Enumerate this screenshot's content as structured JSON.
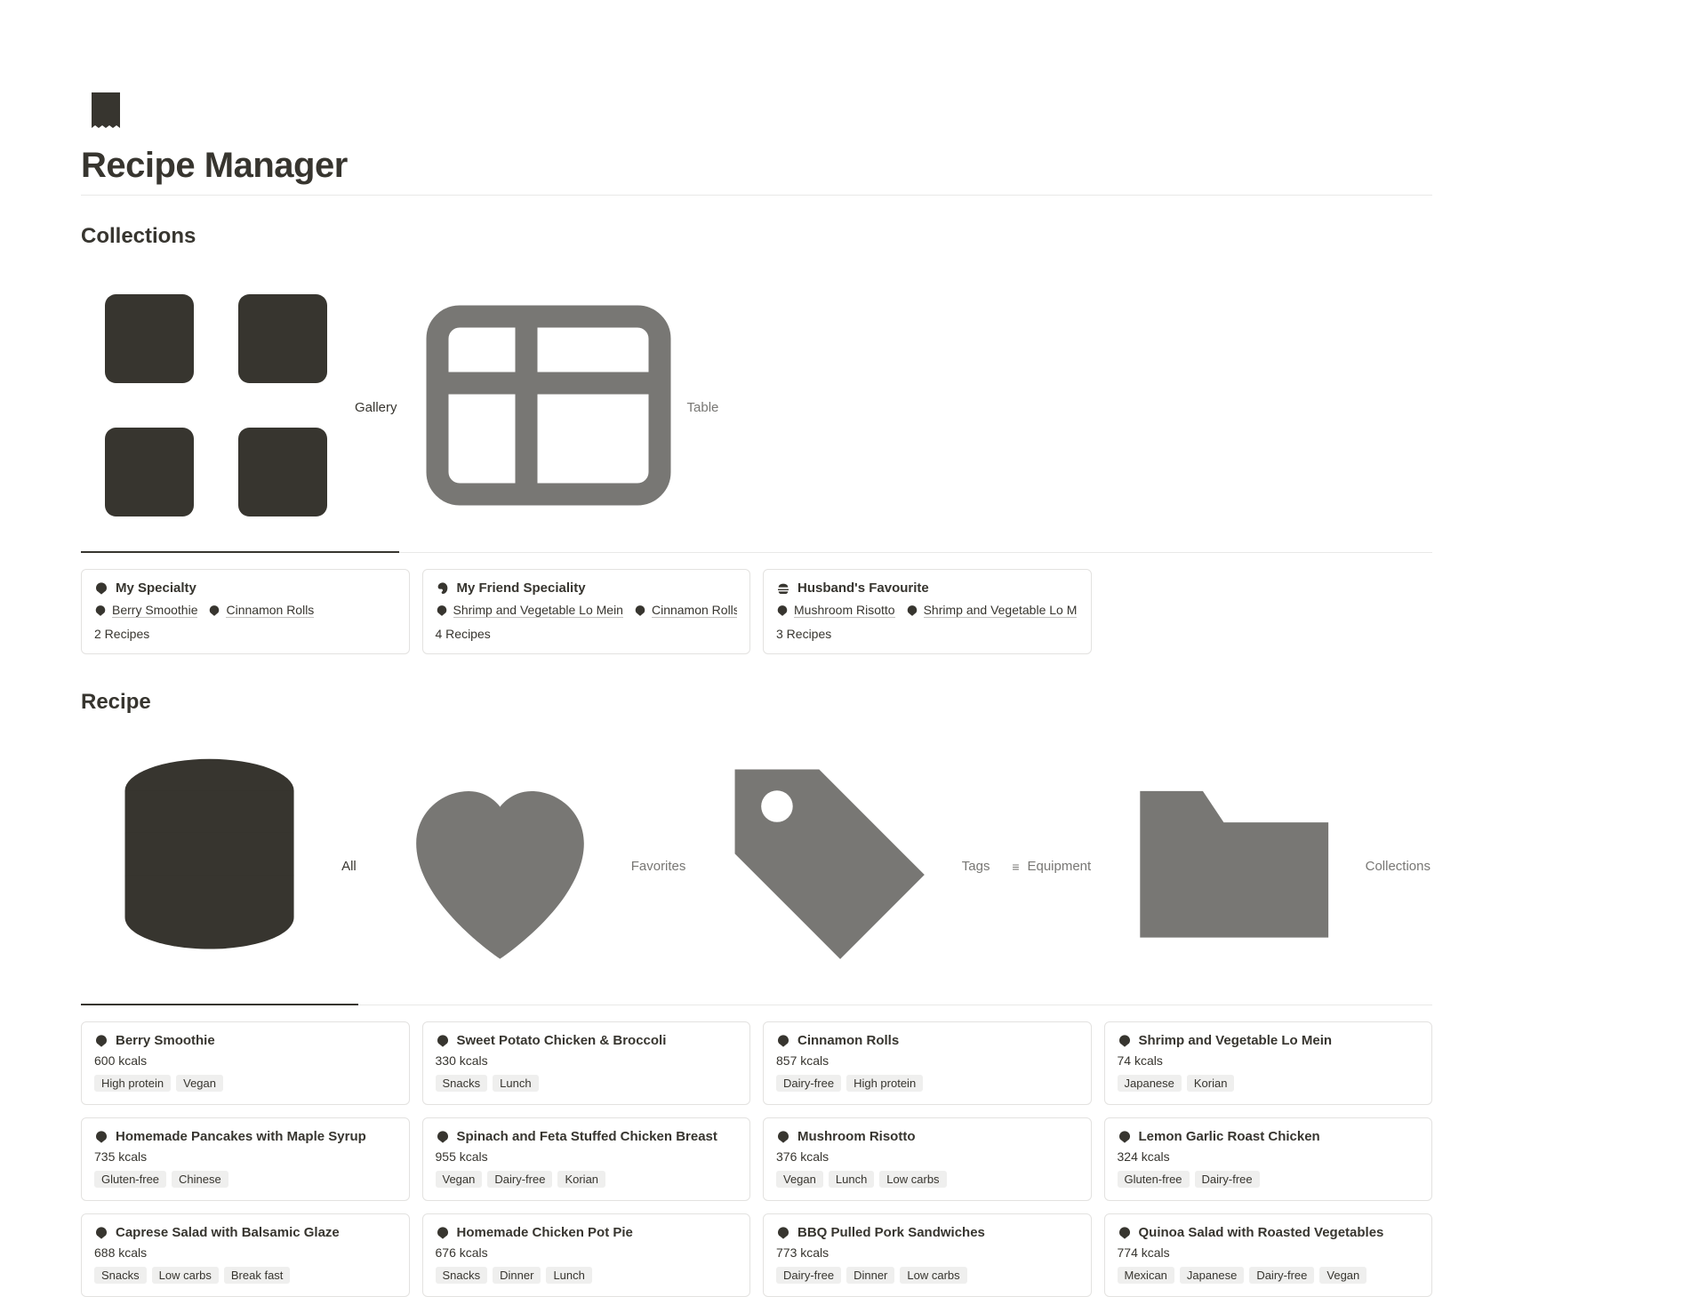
{
  "page": {
    "title": "Recipe Manager"
  },
  "sections": {
    "collections_heading": "Collections",
    "recipe_heading": "Recipe"
  },
  "collection_tabs": [
    {
      "label": "Gallery",
      "icon": "gallery-icon",
      "active": true
    },
    {
      "label": "Table",
      "icon": "table-icon",
      "active": false
    }
  ],
  "collections": [
    {
      "title": "My Specialty",
      "icon": "food-icon",
      "chips": [
        {
          "label": "Berry Smoothie",
          "icon": "food-icon"
        },
        {
          "label": "Cinnamon Rolls",
          "icon": "food-icon"
        }
      ],
      "sub": "2 Recipes"
    },
    {
      "title": "My Friend Speciality",
      "icon": "paint-icon",
      "chips": [
        {
          "label": "Shrimp and Vegetable Lo Mein",
          "icon": "food-icon"
        },
        {
          "label": "Cinnamon Rolls",
          "icon": "food-icon"
        }
      ],
      "sub": "4 Recipes"
    },
    {
      "title": "Husband's Favourite",
      "icon": "burger-icon",
      "chips": [
        {
          "label": "Mushroom Risotto",
          "icon": "food-icon"
        },
        {
          "label": "Shrimp and Vegetable Lo M",
          "icon": "food-icon"
        }
      ],
      "sub": "3 Recipes"
    }
  ],
  "recipe_tabs": [
    {
      "label": "All",
      "icon": "stack-icon",
      "active": true
    },
    {
      "label": "Favorites",
      "icon": "heart-icon",
      "active": false
    },
    {
      "label": "Tags",
      "icon": "tag-icon",
      "active": false
    },
    {
      "label": "Equipment",
      "icon": "equipment-icon",
      "active": false
    },
    {
      "label": "Collections",
      "icon": "folder-icon",
      "active": false
    }
  ],
  "recipes": [
    {
      "title": "Berry Smoothie",
      "kcal": "600 kcals",
      "tags": [
        "High protein",
        "Vegan"
      ]
    },
    {
      "title": "Sweet Potato Chicken & Broccoli",
      "kcal": "330 kcals",
      "tags": [
        "Snacks",
        "Lunch"
      ]
    },
    {
      "title": "Cinnamon Rolls",
      "kcal": "857 kcals",
      "tags": [
        "Dairy-free",
        "High protein"
      ]
    },
    {
      "title": "Shrimp and Vegetable Lo Mein",
      "kcal": "74 kcals",
      "tags": [
        "Japanese",
        "Korian"
      ]
    },
    {
      "title": "Homemade Pancakes with Maple Syrup",
      "kcal": "735 kcals",
      "tags": [
        "Gluten-free",
        "Chinese"
      ]
    },
    {
      "title": "Spinach and Feta Stuffed Chicken Breast",
      "kcal": "955 kcals",
      "tags": [
        "Vegan",
        "Dairy-free",
        "Korian"
      ]
    },
    {
      "title": "Mushroom Risotto",
      "kcal": "376 kcals",
      "tags": [
        "Vegan",
        "Lunch",
        "Low carbs"
      ]
    },
    {
      "title": "Lemon Garlic Roast Chicken",
      "kcal": "324 kcals",
      "tags": [
        "Gluten-free",
        "Dairy-free"
      ]
    },
    {
      "title": "Caprese Salad with Balsamic Glaze",
      "kcal": "688 kcals",
      "tags": [
        "Snacks",
        "Low carbs",
        "Break fast"
      ]
    },
    {
      "title": "Homemade Chicken Pot Pie",
      "kcal": "676 kcals",
      "tags": [
        "Snacks",
        "Dinner",
        "Lunch"
      ]
    },
    {
      "title": "BBQ Pulled Pork Sandwiches",
      "kcal": "773 kcals",
      "tags": [
        "Dairy-free",
        "Dinner",
        "Low carbs"
      ]
    },
    {
      "title": "Quinoa Salad with Roasted Vegetables",
      "kcal": "774 kcals",
      "tags": [
        "Mexican",
        "Japanese",
        "Dairy-free",
        "Vegan"
      ]
    }
  ]
}
